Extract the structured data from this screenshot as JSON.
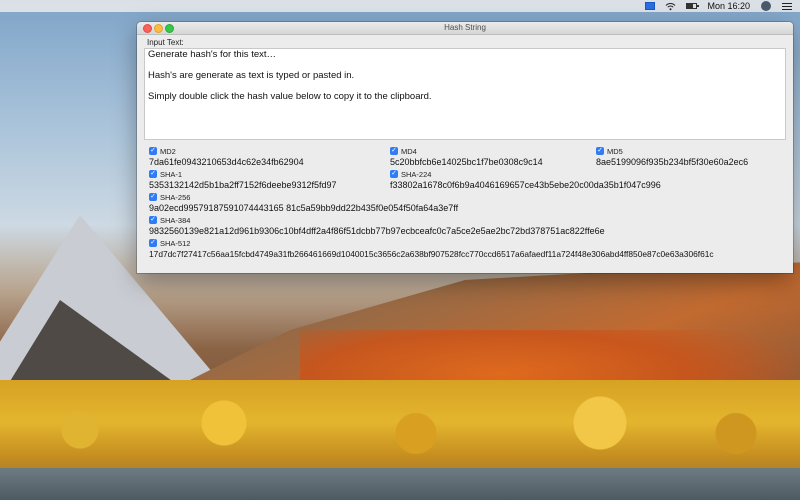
{
  "menubar": {
    "time": "Mon 16:20",
    "icons": [
      "screen-share-icon",
      "wifi-icon",
      "battery-icon",
      "user-icon",
      "menu-list-icon"
    ]
  },
  "window": {
    "title": "Hash String",
    "input_label": "Input Text:",
    "input_lines": [
      "Generate hash's for this text…",
      "Hash's are generate as text is typed or pasted in.",
      "Simply double click the hash value below to copy it to the clipboard."
    ]
  },
  "hashes": {
    "md2": {
      "label": "MD2",
      "checked": true,
      "value": "7da61fe0943210653d4c62e34fb62904"
    },
    "md4": {
      "label": "MD4",
      "checked": true,
      "value": "5c20bbfcb6e14025bc1f7be0308c9c14"
    },
    "md5": {
      "label": "MD5",
      "checked": true,
      "value": "8ae5199096f935b234bf5f30e60a2ec6"
    },
    "sha1": {
      "label": "SHA-1",
      "checked": true,
      "value": "5353132142d5b1ba2ff7152f6deebe9312f5fd97"
    },
    "sha224": {
      "label": "SHA-224",
      "checked": true,
      "value": "f33802a1678c0f6b9a4046169657ce43b5ebe20c00da35b1f047c996"
    },
    "sha256": {
      "label": "SHA-256",
      "checked": true,
      "value": "9a02ecd99579187591074443165 81c5a59bb9dd22b435f0e054f50fa64a3e7ff"
    },
    "sha384": {
      "label": "SHA-384",
      "checked": true,
      "value": "9832560139e821a12d961b9306c10bf4dff2a4f86f51dcbb77b97ecbceafc0c7a5ce2e5ae2bc72bd378751ac822ffe6e"
    },
    "sha512": {
      "label": "SHA-512",
      "checked": true,
      "value": "17d7dc7f27417c56aa15fcbd4749a31fb266461669d1040015c3656c2a638bf907528fcc770ccd6517a6afaedf11a724f48e306abd4ff850e87c0e63a306f61c"
    }
  },
  "checkmark": "✓"
}
